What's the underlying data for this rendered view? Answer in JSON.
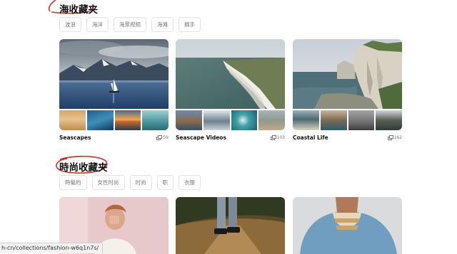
{
  "sections": [
    {
      "title": "海收藏夹",
      "tags": [
        "波浪",
        "海洋",
        "海景视频",
        "海滩",
        "搁手"
      ],
      "collections": [
        {
          "title": "Seascapes",
          "count": "59"
        },
        {
          "title": "Seascape Videos",
          "count": "103"
        },
        {
          "title": "Coastal Life",
          "count": "162"
        }
      ]
    },
    {
      "title": "時尚收藏夹",
      "tags": [
        "時髦的",
        "女性时尚",
        "时尚",
        "职",
        "衣服"
      ]
    }
  ],
  "status_bar": {
    "url": "h-cn/collections/fashion-w6q1n7s/"
  },
  "colors": {
    "annotation": "#d42b1c",
    "tag_border": "#e3e3e3",
    "muted_text": "#767676"
  }
}
